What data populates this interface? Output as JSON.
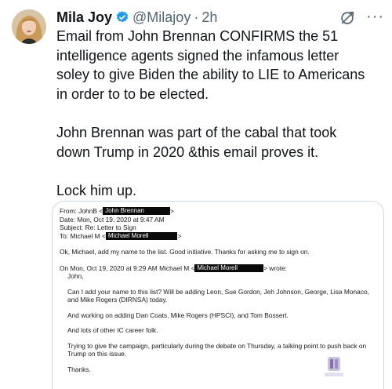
{
  "tweet": {
    "author_name": "Mila Joy",
    "handle": "@Milajoy",
    "separator": "·",
    "time": "2h",
    "more_label": "···",
    "text_lines": [
      "Email from John Brennan CONFIRMS the 51",
      "intelligence agents signed the infamous letter",
      "soley to give Biden the ability to LIE to Americans",
      "in order to to be elected."
    ],
    "text_para2": [
      "John Brennan was part of the cabal that took",
      "down Trump in 2020 &this email proves it."
    ],
    "text_para3": "Lock him up."
  },
  "email": {
    "from_label": "From: JohnB <",
    "from_redacted": "John Brennan",
    "from_end": ">",
    "date": "Date: Mon, Oct 19, 2020 at 9:47 AM",
    "subject": "Subject: Re: Letter to Sign",
    "to_label": "To: Michael M <",
    "to_redacted": "Michael Morell",
    "to_end": ">",
    "reply": "Ok, Michael, add my name to the list.  Good initiative.  Thanks for asking me to sign on.",
    "quote_header_pre": "On Mon, Oct 19, 2020 at 9:29 AM Michael M <",
    "quote_header_redacted": "Michael Morell",
    "quote_header_post": "> wrote:",
    "q_greeting": "John,",
    "q_para1": "Can I add your name to this list?  Will be adding Leon, Sue Gordon, Jeh Johnson, George, Lisa Monaco, and Mike Rogers (DIRNSA) today.",
    "q_para2": "And working on adding Dan Coats, Mike Rogers (HPSCI), and Tom Bossert.",
    "q_para3": "And lots of other IC career folk.",
    "q_para4": "Trying to give the campaign, particularly during the debate on Thursday, a talking point to push back on Trump on this issue.",
    "q_thanks": "Thanks."
  },
  "colors": {
    "text": "#0f1419",
    "secondary": "#536471",
    "verified": "#1d9bf0",
    "border": "#cfd9de",
    "redaction": "#0a0a0a"
  },
  "icons": {
    "verified": "verified-badge-icon",
    "grok": "grok-icon",
    "more": "more-icon"
  }
}
